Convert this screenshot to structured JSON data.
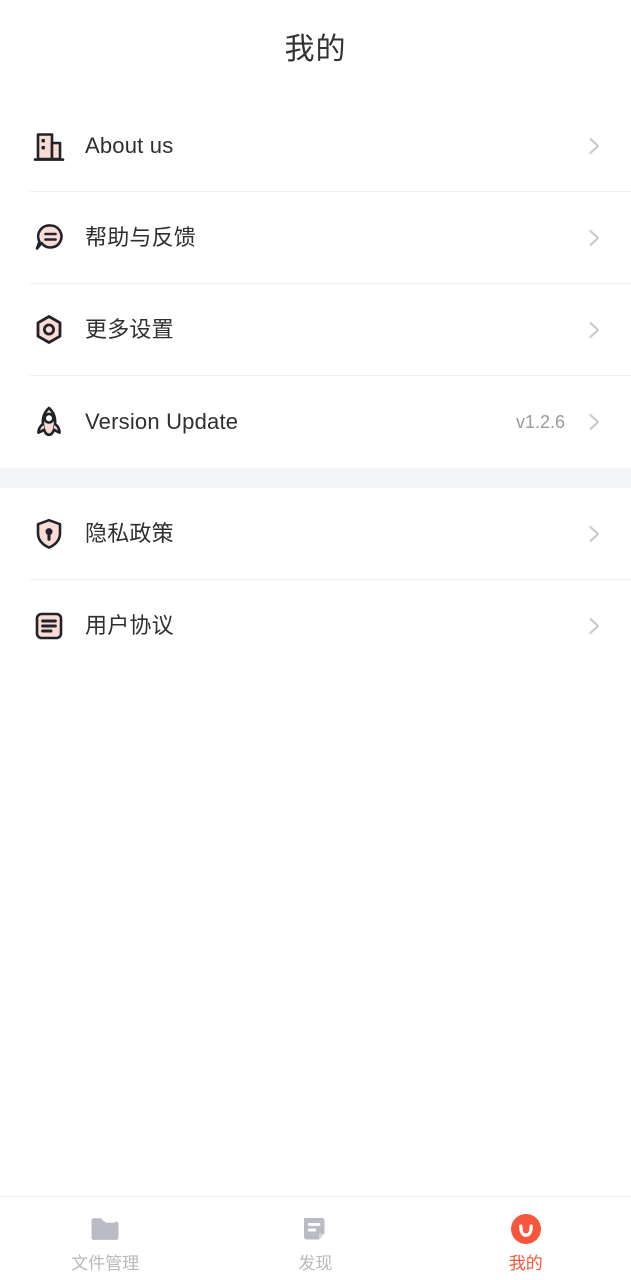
{
  "header": {
    "title": "我的"
  },
  "colors": {
    "accent": "#f8563c",
    "icon_dark": "#22232a",
    "icon_fill": "#fadcd4",
    "divider": "#f0f0f2",
    "group_gap": "#f4f5f8",
    "label_text": "#2f2f33",
    "value_text": "#9a9a9f",
    "tab_inactive": "#b8b9bd",
    "tab_icon_inactive": "#b9bcc4",
    "chevron": "#c9cacd"
  },
  "settings_groups": [
    {
      "id": "group-main",
      "rows": [
        {
          "id": "about-us",
          "label": "About us",
          "icon": "building-icon",
          "value": ""
        },
        {
          "id": "help-feedback",
          "label": "帮助与反馈",
          "icon": "chat-bubble-icon",
          "value": ""
        },
        {
          "id": "more-settings",
          "label": "更多设置",
          "icon": "hex-gear-icon",
          "value": ""
        },
        {
          "id": "version-update",
          "label": "Version Update",
          "icon": "rocket-icon",
          "value": "v1.2.6"
        }
      ]
    },
    {
      "id": "group-legal",
      "rows": [
        {
          "id": "privacy-policy",
          "label": "隐私政策",
          "icon": "shield-lock-icon",
          "value": ""
        },
        {
          "id": "user-agreement",
          "label": "用户协议",
          "icon": "document-lines-icon",
          "value": ""
        }
      ]
    }
  ],
  "tabbar": {
    "items": [
      {
        "id": "file-manager",
        "label": "文件管理",
        "icon": "folder-icon",
        "active": false
      },
      {
        "id": "discover",
        "label": "发现",
        "icon": "note-page-icon",
        "active": false
      },
      {
        "id": "mine",
        "label": "我的",
        "icon": "smile-circle-icon",
        "active": true
      }
    ]
  }
}
